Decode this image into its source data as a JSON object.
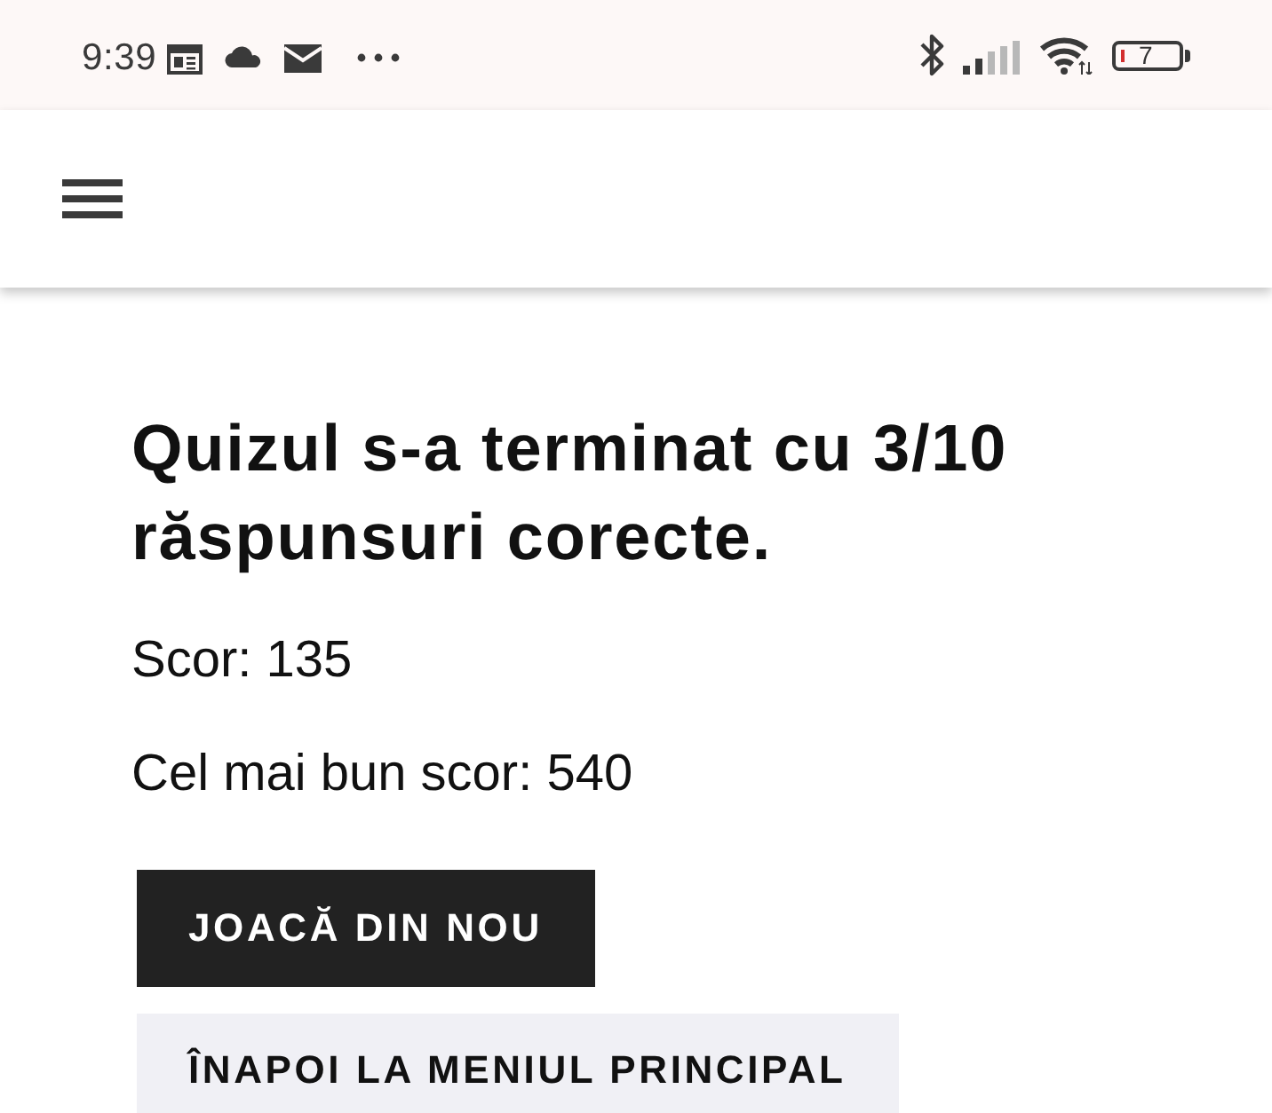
{
  "status_bar": {
    "time": "9:39",
    "battery": "7"
  },
  "result": {
    "title": "Quizul s-a terminat cu 3/10 răspunsuri corecte.",
    "score": "Scor: 135",
    "best_score": "Cel mai bun scor: 540"
  },
  "buttons": [
    {
      "label": "JOACĂ DIN NOU",
      "kind": "primary"
    },
    {
      "label": "ÎNAPOI LA MENIUL PRINCIPAL",
      "kind": "secondary"
    }
  ]
}
